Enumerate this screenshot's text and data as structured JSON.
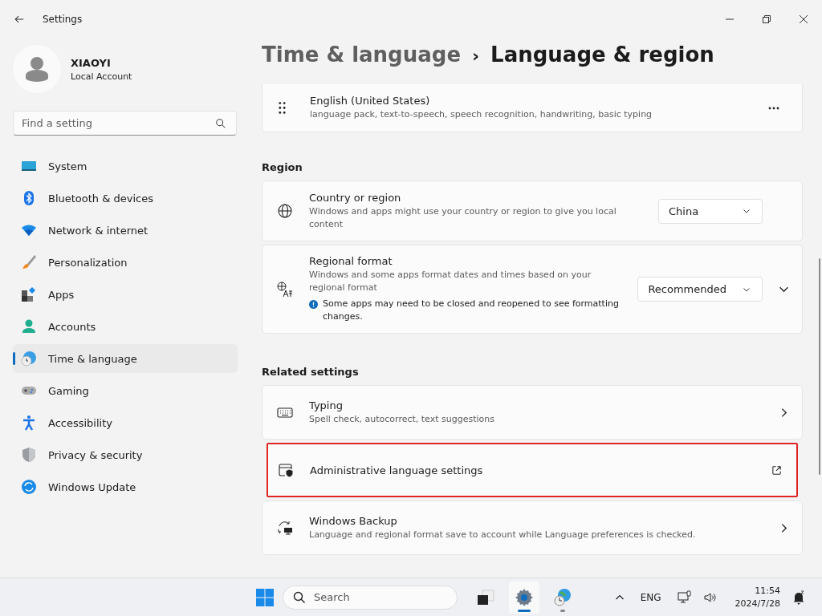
{
  "window": {
    "title": "Settings"
  },
  "account": {
    "name": "XIAOYI",
    "type": "Local Account"
  },
  "search": {
    "placeholder": "Find a setting"
  },
  "sidebar": {
    "items": [
      {
        "label": "System",
        "selected": false
      },
      {
        "label": "Bluetooth & devices",
        "selected": false
      },
      {
        "label": "Network & internet",
        "selected": false
      },
      {
        "label": "Personalization",
        "selected": false
      },
      {
        "label": "Apps",
        "selected": false
      },
      {
        "label": "Accounts",
        "selected": false
      },
      {
        "label": "Time & language",
        "selected": true
      },
      {
        "label": "Gaming",
        "selected": false
      },
      {
        "label": "Accessibility",
        "selected": false
      },
      {
        "label": "Privacy & security",
        "selected": false
      },
      {
        "label": "Windows Update",
        "selected": false
      }
    ]
  },
  "breadcrumb": {
    "parent": "Time & language",
    "separator": "›",
    "current": "Language & region"
  },
  "language": {
    "name": "English (United States)",
    "features": "language pack, text-to-speech, speech recognition, handwriting, basic typing"
  },
  "region": {
    "heading": "Region",
    "items": [
      {
        "title": "Country or region",
        "description": "Windows and apps might use your country or region to give you local content",
        "value": "China",
        "expandable": false
      },
      {
        "title": "Regional format",
        "description": "Windows and some apps format dates and times based on your regional format",
        "note": "Some apps may need to be closed and reopened to see formatting changes.",
        "value": "Recommended",
        "expandable": true
      }
    ]
  },
  "related": {
    "heading": "Related settings",
    "items": [
      {
        "title": "Typing",
        "description": "Spell check, autocorrect, text suggestions",
        "kind": "nav",
        "highlighted": false
      },
      {
        "title": "Administrative language settings",
        "kind": "external",
        "highlighted": true
      },
      {
        "title": "Windows Backup",
        "description": "Language and regional format save to account while Language preferences is checked.",
        "kind": "nav",
        "highlighted": false
      }
    ]
  },
  "taskbar": {
    "search_placeholder": "Search",
    "apps": [
      {
        "selected": false
      },
      {
        "selected": true
      },
      {
        "selected": false
      }
    ],
    "language": "ENG",
    "time": "11:54",
    "date": "2024/7/28"
  }
}
